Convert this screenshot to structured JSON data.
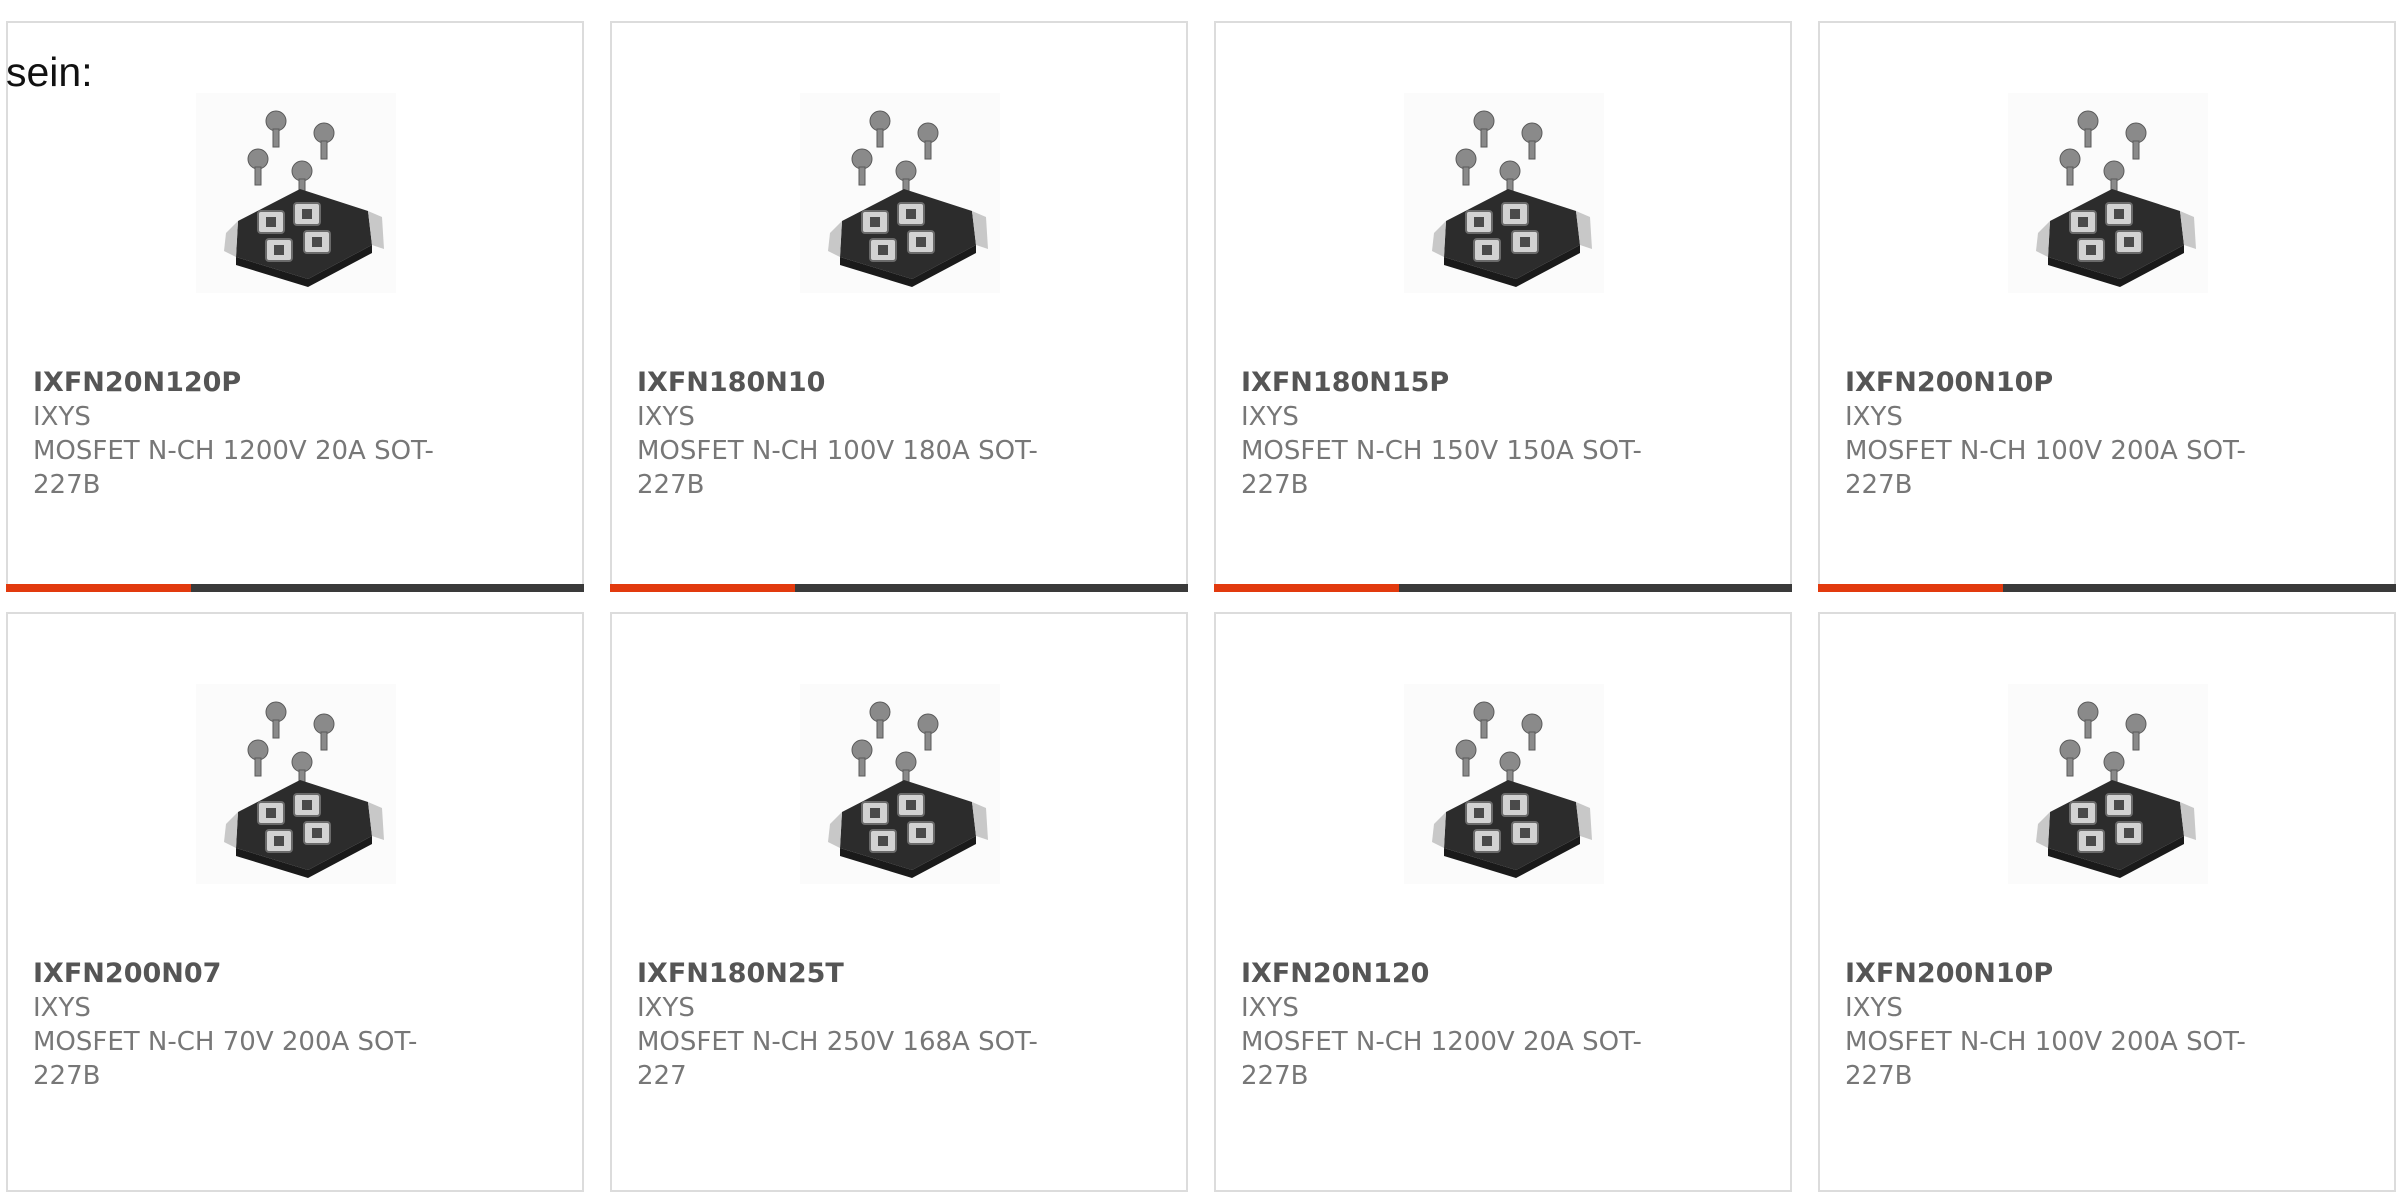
{
  "intro": {
    "text": "sein:"
  },
  "colors": {
    "accent": "#e23a0e",
    "bar_track": "#3a3a3a",
    "border": "#dcdcdc",
    "text_muted": "#777777",
    "text_strong": "#555555"
  },
  "products": [
    {
      "part_number": "IXFN20N120P",
      "manufacturer": "IXYS",
      "description": "MOSFET N-CH 1200V 20A SOT-227B",
      "image_icon": "sot-227b-module-icon",
      "progress": 0.32
    },
    {
      "part_number": "IXFN180N10",
      "manufacturer": "IXYS",
      "description": "MOSFET N-CH 100V 180A SOT-227B",
      "image_icon": "sot-227b-module-icon",
      "progress": 0.32
    },
    {
      "part_number": "IXFN180N15P",
      "manufacturer": "IXYS",
      "description": "MOSFET N-CH 150V 150A SOT-227B",
      "image_icon": "sot-227b-module-icon",
      "progress": 0.32
    },
    {
      "part_number": "IXFN200N10P",
      "manufacturer": "IXYS",
      "description": "MOSFET N-CH 100V 200A SOT-227B",
      "image_icon": "sot-227b-module-icon",
      "progress": 0.32
    },
    {
      "part_number": "IXFN200N07",
      "manufacturer": "IXYS",
      "description": "MOSFET N-CH 70V 200A SOT-227B",
      "image_icon": "sot-227b-module-icon"
    },
    {
      "part_number": "IXFN180N25T",
      "manufacturer": "IXYS",
      "description": "MOSFET N-CH 250V 168A SOT-227",
      "image_icon": "sot-227b-module-icon"
    },
    {
      "part_number": "IXFN20N120",
      "manufacturer": "IXYS",
      "description": "MOSFET N-CH 1200V 20A SOT-227B",
      "image_icon": "sot-227b-module-icon"
    },
    {
      "part_number": "IXFN200N10P",
      "manufacturer": "IXYS",
      "description": "MOSFET N-CH 100V 200A SOT-227B",
      "image_icon": "sot-227b-module-icon"
    }
  ]
}
